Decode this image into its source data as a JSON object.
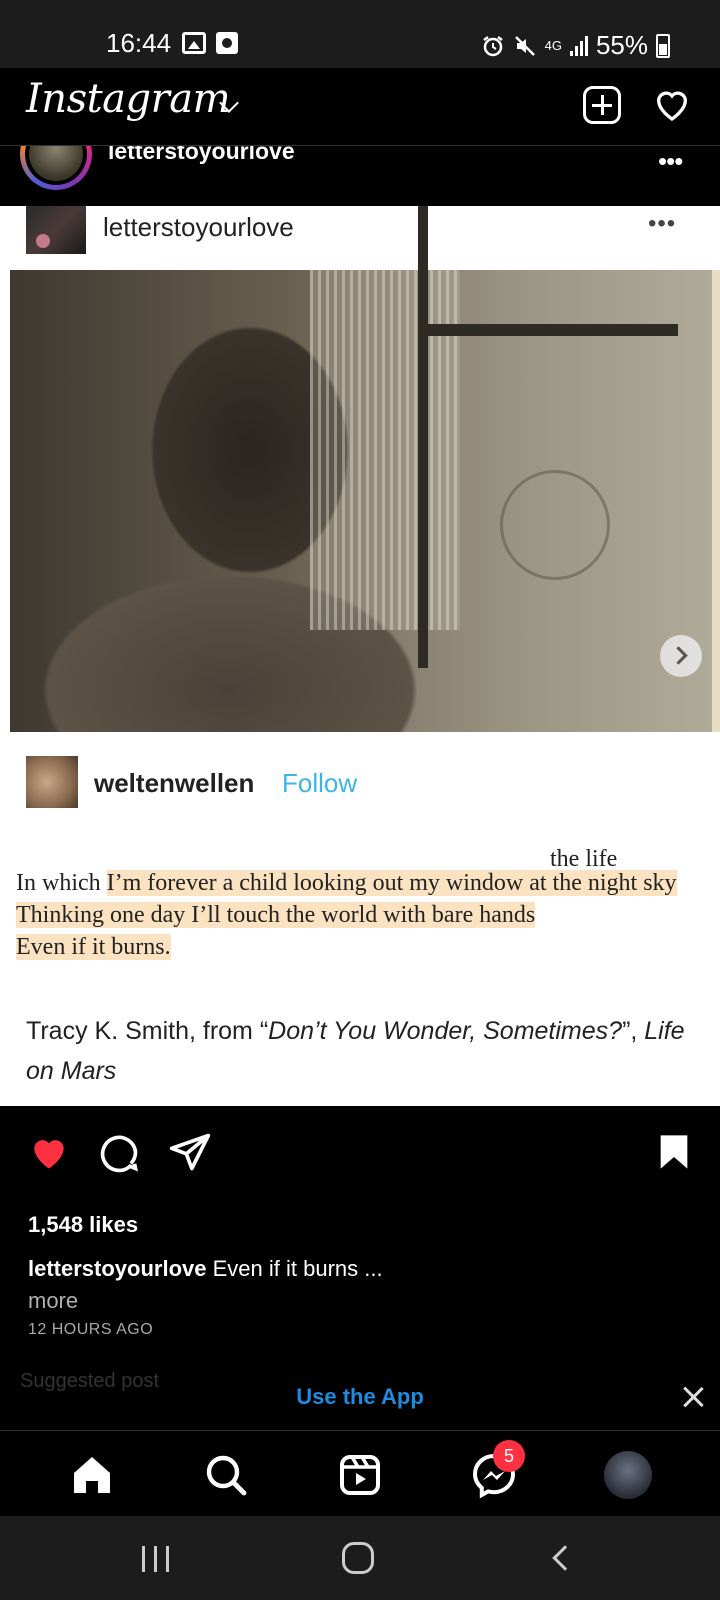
{
  "status_bar": {
    "time": "16:44",
    "network": "4G",
    "battery": "55%"
  },
  "header": {
    "logo": "Instagram",
    "new_post_icon": "plus-square-icon",
    "activity_icon": "heart-outline-icon"
  },
  "post": {
    "username": "letterstoyourlove",
    "more": "•••",
    "image": {
      "inner_username": "letterstoyourlove",
      "inner_more": "•••",
      "tumblr_username": "weltenwellen",
      "tumblr_follow": "Follow",
      "poem_title": "the life",
      "poem_line1_plain": "In which ",
      "poem_line1_hl": "I’m forever a child looking out my window at the night sky",
      "poem_line2_hl": "Thinking one day I’ll touch the world with bare hands",
      "poem_line3_hl": "Even if it burns.",
      "attrib_prefix": "Tracy K. Smith, from “",
      "attrib_work": "Don’t You Wonder, Sometimes?",
      "attrib_mid": "”, ",
      "attrib_book": "Life on Mars"
    },
    "likes": "1,548 likes",
    "caption_user": "letterstoyourlove",
    "caption_text": " Even if it burns ...",
    "more_label": "more",
    "time_ago": "12 HOURS AGO",
    "liked": true,
    "saved": true
  },
  "suggested": "Suggested post",
  "use_app": {
    "label": "Use the App"
  },
  "tabbar": {
    "messages_badge": "5"
  },
  "colors": {
    "like_red": "#ff3040",
    "link_blue": "#1d8ce0",
    "follow_blue": "#3bb5e8",
    "highlight": "#fbe2c0"
  }
}
